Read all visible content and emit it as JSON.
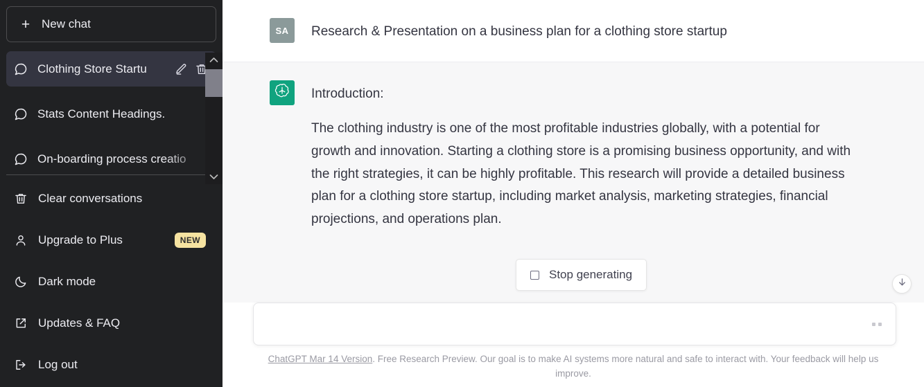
{
  "sidebar": {
    "new_chat_label": "New chat",
    "chats": [
      {
        "label": "Clothing Store Startu",
        "active": true,
        "truncated": false
      },
      {
        "label": "Stats Content Headings.",
        "active": false,
        "truncated": false
      },
      {
        "label": "On-boarding process creatio",
        "active": false,
        "truncated": true
      }
    ],
    "chat_actions": {
      "edit": "edit-icon",
      "delete": "delete-icon"
    },
    "menu": [
      {
        "label": "Clear conversations",
        "icon": "trash-icon",
        "badge": ""
      },
      {
        "label": "Upgrade to Plus",
        "icon": "user-icon",
        "badge": "NEW"
      },
      {
        "label": "Dark mode",
        "icon": "moon-icon",
        "badge": ""
      },
      {
        "label": "Updates & FAQ",
        "icon": "external-link-icon",
        "badge": ""
      },
      {
        "label": "Log out",
        "icon": "logout-icon",
        "badge": ""
      }
    ],
    "scrollbar": {
      "up": "▲",
      "down": "▼"
    },
    "colors": {
      "background": "#202123",
      "active_item": "#343541",
      "badge": "#f6e3a1"
    }
  },
  "conversation": {
    "user": {
      "avatar_initials": "SA",
      "text": "Research & Presentation on a business plan for a clothing store startup"
    },
    "assistant": {
      "avatar": "openai-logo-icon",
      "heading": "Introduction:",
      "paragraph": "The clothing industry is one of the most profitable industries globally, with a potential for growth and innovation. Starting a clothing store is a promising business opportunity, and with the right strategies, it can be highly profitable. This research will provide a detailed business plan for a clothing store startup, including market analysis, marketing strategies, financial projections, and operations plan."
    }
  },
  "controls": {
    "stop_generating_label": "Stop generating",
    "scroll_to_bottom_icon": "arrow-down-icon"
  },
  "composer": {
    "value": "",
    "placeholder": ""
  },
  "footer": {
    "link_text": "ChatGPT Mar 14 Version",
    "rest_text": ". Free Research Preview. Our goal is to make AI systems more natural and safe to interact with. Your feedback will help us improve."
  },
  "theme": {
    "accent": "#10a37f",
    "user_avatar": "#8b9a9a",
    "assistant_bg": "#f7f7f8",
    "text": "#343541"
  }
}
